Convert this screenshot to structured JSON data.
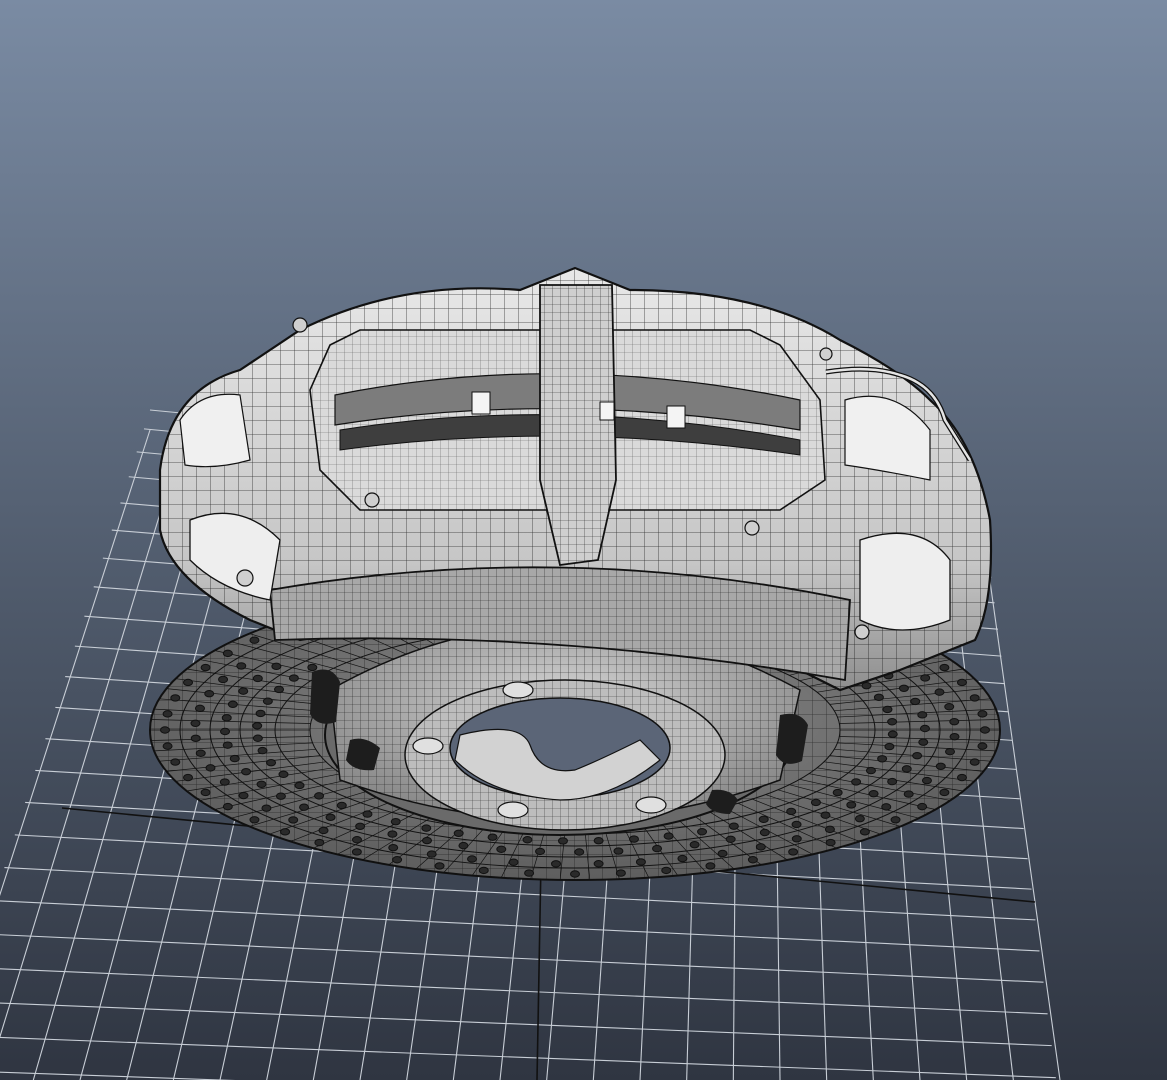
{
  "viewport": {
    "background_top": "#7a8ba3",
    "background_bottom": "#2f3541",
    "grid_color": "#c8ced6",
    "grid_axis_color": "#111111",
    "mesh_fill_light": "#d9d9d9",
    "mesh_fill_mid": "#8e8e8e",
    "mesh_fill_dark": "#4d4d4d",
    "wire_color": "#111111"
  }
}
